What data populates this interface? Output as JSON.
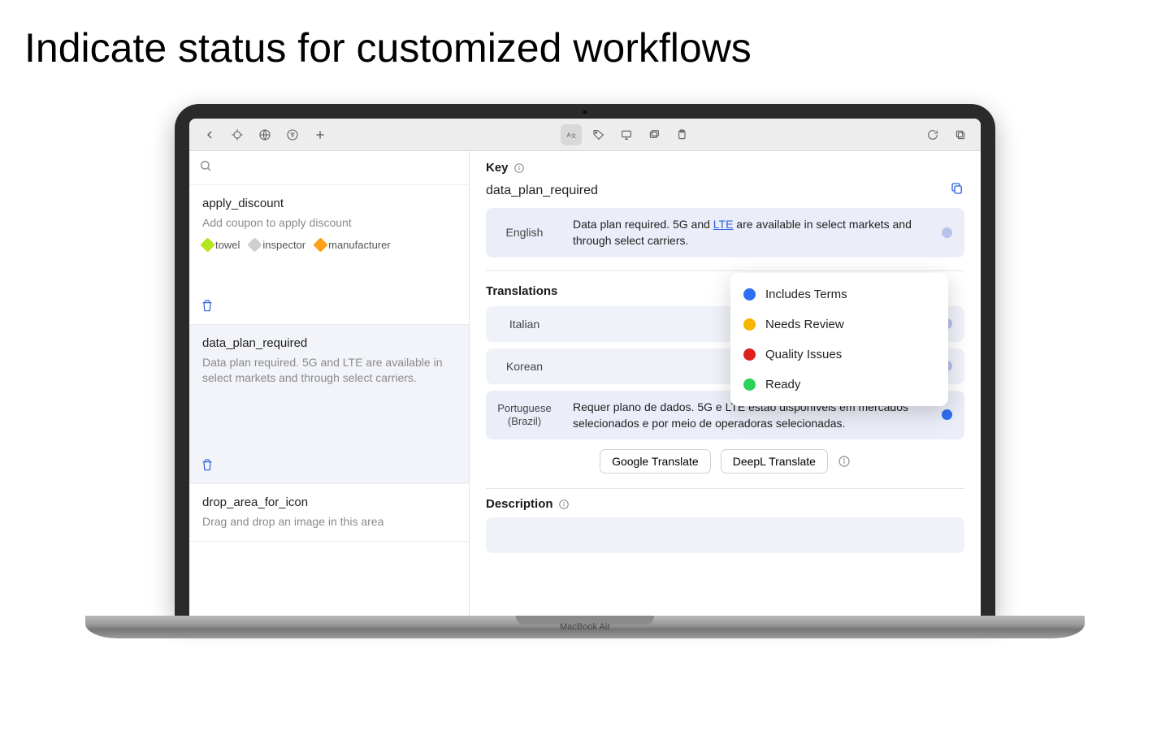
{
  "page": {
    "title": "Indicate status for customized workflows"
  },
  "device": {
    "label": "MacBook Air"
  },
  "sidebar": {
    "items": [
      {
        "key": "apply_discount",
        "desc": "Add coupon to apply discount",
        "tags": [
          {
            "label": "towel",
            "color": "#b6e61d"
          },
          {
            "label": "inspector",
            "color": "#cfcfcf"
          },
          {
            "label": "manufacturer",
            "color": "#ff9f1a"
          }
        ]
      },
      {
        "key": "data_plan_required",
        "desc": "Data plan required. 5G and LTE are available in select markets and through select carriers."
      },
      {
        "key": "drop_area_for_icon",
        "desc": "Drag and drop an image in this area"
      }
    ]
  },
  "detail": {
    "key_label": "Key",
    "key_name": "data_plan_required",
    "source_lang": "English",
    "source_text_before": "Data plan required. 5G and ",
    "source_text_link": "LTE",
    "source_text_after": " are available in select markets and through select carriers.",
    "translations_label": "Translations",
    "translations": [
      {
        "lang": "Italian",
        "text": "",
        "status_color": "#b8c2ea"
      },
      {
        "lang": "Korean",
        "text": "",
        "status_color": "#b8c2ea"
      },
      {
        "lang": "Portuguese (Brazil)",
        "text": "Requer plano de dados. 5G e LTE estão disponíveis em mercados selecionados e por meio de operadoras selecionadas.",
        "status_color": "#2d6ff0"
      }
    ],
    "buttons": {
      "google": "Google Translate",
      "deepl": "DeepL Translate"
    },
    "description_label": "Description"
  },
  "status_menu": [
    {
      "label": "Includes Terms",
      "color": "#2d6ff0"
    },
    {
      "label": "Needs Review",
      "color": "#f7b500"
    },
    {
      "label": "Quality Issues",
      "color": "#e02020"
    },
    {
      "label": "Ready",
      "color": "#29d35b"
    }
  ],
  "colors": {
    "muted_dot": "#b8c2ea"
  }
}
